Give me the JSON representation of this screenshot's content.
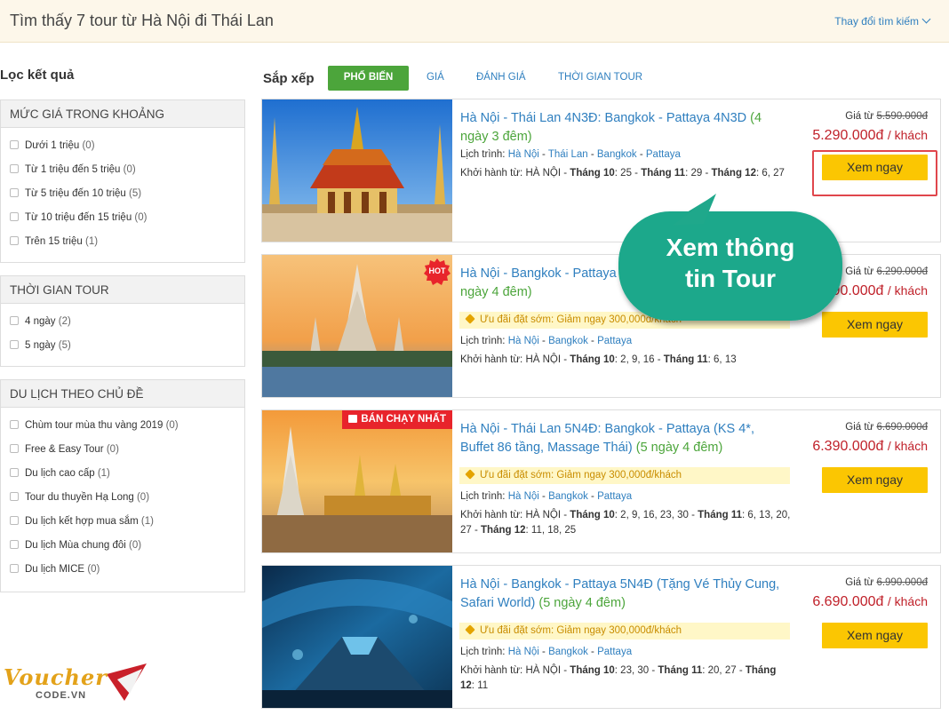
{
  "header": {
    "title": "Tìm thấy 7 tour từ Hà Nội đi Thái Lan",
    "change_search": "Thay đổi tìm kiếm"
  },
  "filters": {
    "title": "Lọc kết quả",
    "price": {
      "heading": "MỨC GIÁ TRONG KHOẢNG",
      "items": [
        {
          "label": "Dưới 1 triệu",
          "count": "(0)"
        },
        {
          "label": "Từ 1 triệu đến 5 triệu",
          "count": "(0)"
        },
        {
          "label": "Từ 5 triệu đến 10 triệu",
          "count": "(5)"
        },
        {
          "label": "Từ 10 triệu đến 15 triệu",
          "count": "(0)"
        },
        {
          "label": "Trên 15 triệu",
          "count": "(1)"
        }
      ]
    },
    "duration": {
      "heading": "THỜI GIAN TOUR",
      "items": [
        {
          "label": "4 ngày",
          "count": "(2)"
        },
        {
          "label": "5 ngày",
          "count": "(5)"
        }
      ]
    },
    "theme": {
      "heading": "DU LỊCH THEO CHỦ ĐỀ",
      "items": [
        {
          "label": "Chùm tour mùa thu vàng 2019",
          "count": "(0)"
        },
        {
          "label": "Free & Easy Tour",
          "count": "(0)"
        },
        {
          "label": "Du lịch cao cấp",
          "count": "(1)"
        },
        {
          "label": "Tour du thuyền Hạ Long",
          "count": "(0)"
        },
        {
          "label": "Du lịch kết hợp mua sắm",
          "count": "(1)"
        },
        {
          "label": "Du lịch Mùa chung đôi",
          "count": "(0)"
        },
        {
          "label": "Du lịch MICE",
          "count": "(0)"
        }
      ]
    }
  },
  "sort": {
    "label": "Sắp xếp",
    "options": [
      "PHỔ BIẾN",
      "GIÁ",
      "ĐÁNH GIÁ",
      "THỜI GIAN TOUR"
    ]
  },
  "common": {
    "from_label": "Giá từ",
    "per_guest": "/ khách",
    "route_label": "Lịch trình:",
    "depart_label": "Khởi hành từ:",
    "depart_city": "HÀ NỘI",
    "view_button": "Xem ngay",
    "promo_text": "Ưu đãi đặt sớm: Giảm ngay 300,000đ/khách",
    "sep": " - "
  },
  "tours": [
    {
      "name": "Hà Nội - Thái Lan 4N3Đ: Bangkok - Pattaya 4N3D",
      "duration": "(4 ngày 3 đêm)",
      "old_price": "5.590.000đ",
      "price": "5.290.000đ",
      "route": [
        "Hà Nội",
        "Thái Lan",
        "Bangkok",
        "Pattaya"
      ],
      "months": [
        {
          "label": "Tháng 10",
          "days": "25"
        },
        {
          "label": "Tháng 11",
          "days": "29"
        },
        {
          "label": "Tháng 12",
          "days": "6, 27"
        }
      ]
    },
    {
      "name": "Hà Nội - Bangkok - Pattaya 5N4Đ (Khách sạn 4*)",
      "duration": "(5 ngày 4 đêm)",
      "old_price": "6.290.000đ",
      "price": "5.990.000đ",
      "badge": "HOT",
      "route": [
        "Hà Nội",
        "Bangkok",
        "Pattaya"
      ],
      "months": [
        {
          "label": "Tháng 10",
          "days": "2, 9, 16"
        },
        {
          "label": "Tháng 11",
          "days": "6, 13"
        }
      ]
    },
    {
      "name": "Hà Nội - Thái Lan 5N4Đ: Bangkok - Pattaya (KS 4*, Buffet 86 tầng, Massage Thái)",
      "duration": "(5 ngày 4 đêm)",
      "old_price": "6.690.000đ",
      "price": "6.390.000đ",
      "badge": "BÁN CHẠY NHẤT",
      "route": [
        "Hà Nội",
        "Bangkok",
        "Pattaya"
      ],
      "months": [
        {
          "label": "Tháng 10",
          "days": "2, 9, 16, 23, 30"
        },
        {
          "label": "Tháng 11",
          "days": "6, 13, 20, 27"
        },
        {
          "label": "Tháng 12",
          "days": "11, 18, 25"
        }
      ]
    },
    {
      "name": "Hà Nội - Bangkok - Pattaya 5N4Đ (Tặng Vé Thủy Cung, Safari World)",
      "duration": "(5 ngày 4 đêm)",
      "old_price": "6.990.000đ",
      "price": "6.690.000đ",
      "route": [
        "Hà Nội",
        "Bangkok",
        "Pattaya"
      ],
      "months": [
        {
          "label": "Tháng 10",
          "days": "23, 30"
        },
        {
          "label": "Tháng 11",
          "days": "20, 27"
        },
        {
          "label": "Tháng 12",
          "days": "11"
        }
      ]
    }
  ],
  "callout": {
    "line1": "Xem thông",
    "line2": "tin Tour",
    "color": "#1fa88b"
  },
  "watermark": {
    "brand": "Voucher",
    "sub": "CODE.VN"
  },
  "colors": {
    "link": "#2f7fbf",
    "green": "#4ca53b",
    "price": "#c0212a",
    "button": "#fbc602",
    "promo_bg": "#fff7c7"
  }
}
